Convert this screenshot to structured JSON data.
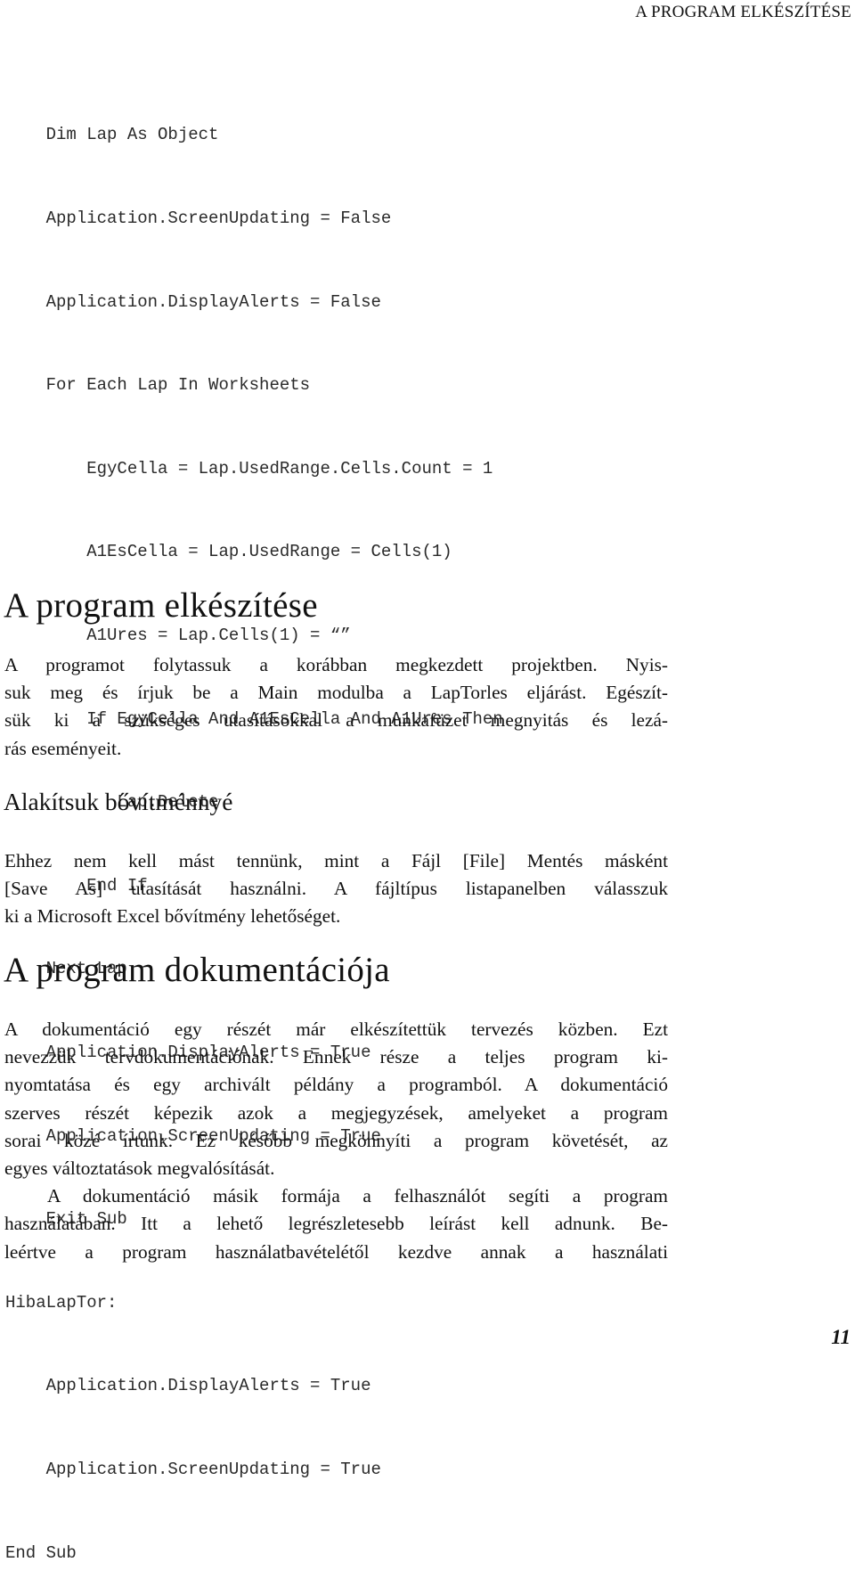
{
  "header": {
    "running_title": "A PROGRAM ELKÉSZÍTÉSE"
  },
  "code_block": {
    "lines": [
      "    Dim Lap As Object",
      "    Application.ScreenUpdating = False",
      "    Application.DisplayAlerts = False",
      "    For Each Lap In Worksheets",
      "        EgyCella = Lap.UsedRange.Cells.Count = 1",
      "        A1EsCella = Lap.UsedRange = Cells(1)",
      "        A1Ures = Lap.Cells(1) = “”",
      "        If EgyCella And A1EsCella And A1Ures Then",
      "           Lap.Delete",
      "        End If",
      "    Next Lap",
      "    Application.DisplayAlerts = True",
      "    Application.ScreenUpdating = True",
      "    Exit Sub",
      "HibaLapTor:",
      "    Application.DisplayAlerts = True",
      "    Application.ScreenUpdating = True",
      "End Sub"
    ]
  },
  "sections": [
    {
      "heading": "A program elkészítése",
      "paragraph_lines": [
        "A programot folytassuk a korábban megkezdett projektben. Nyis-",
        "suk meg és írjuk be a Main modulba a LapTorles eljárást. Egészít-",
        "sük ki a szükséges utasításokkal a munkafüzet megnyitás és lezá-",
        "rás eseményeit."
      ]
    },
    {
      "heading": "Alakítsuk bővítménnyé",
      "paragraph_lines": [
        "Ehhez nem kell mást tennünk, mint a Fájl [File] Mentés másként",
        "[Save As] utasítását használni. A fájltípus listapanelben válasszuk",
        "ki a Microsoft Excel bővítmény lehetőséget."
      ]
    },
    {
      "heading": "A program dokumentációja",
      "paragraph_lines": [
        "A dokumentáció egy részét már elkészítettük tervezés közben. Ezt",
        "nevezzük tervdokumentációnak. Ennek része a teljes program ki-",
        "nyomtatása és egy archivált példány a programból. A dokumentáció",
        "szerves részét képezik azok a megjegyzések, amelyeket a program",
        "sorai közé írtunk. Ez később megkönnyíti a program követését, az",
        "egyes változtatások megvalósítását."
      ],
      "paragraph2_lines": [
        "A dokumentáció másik formája a felhasználót segíti a program",
        "használatában. Itt a lehető legrészletesebb leírást kell adnunk. Be-",
        "leértve a program használatbavételétől kezdve annak a használati"
      ]
    }
  ],
  "footer": {
    "page_number": "11"
  }
}
